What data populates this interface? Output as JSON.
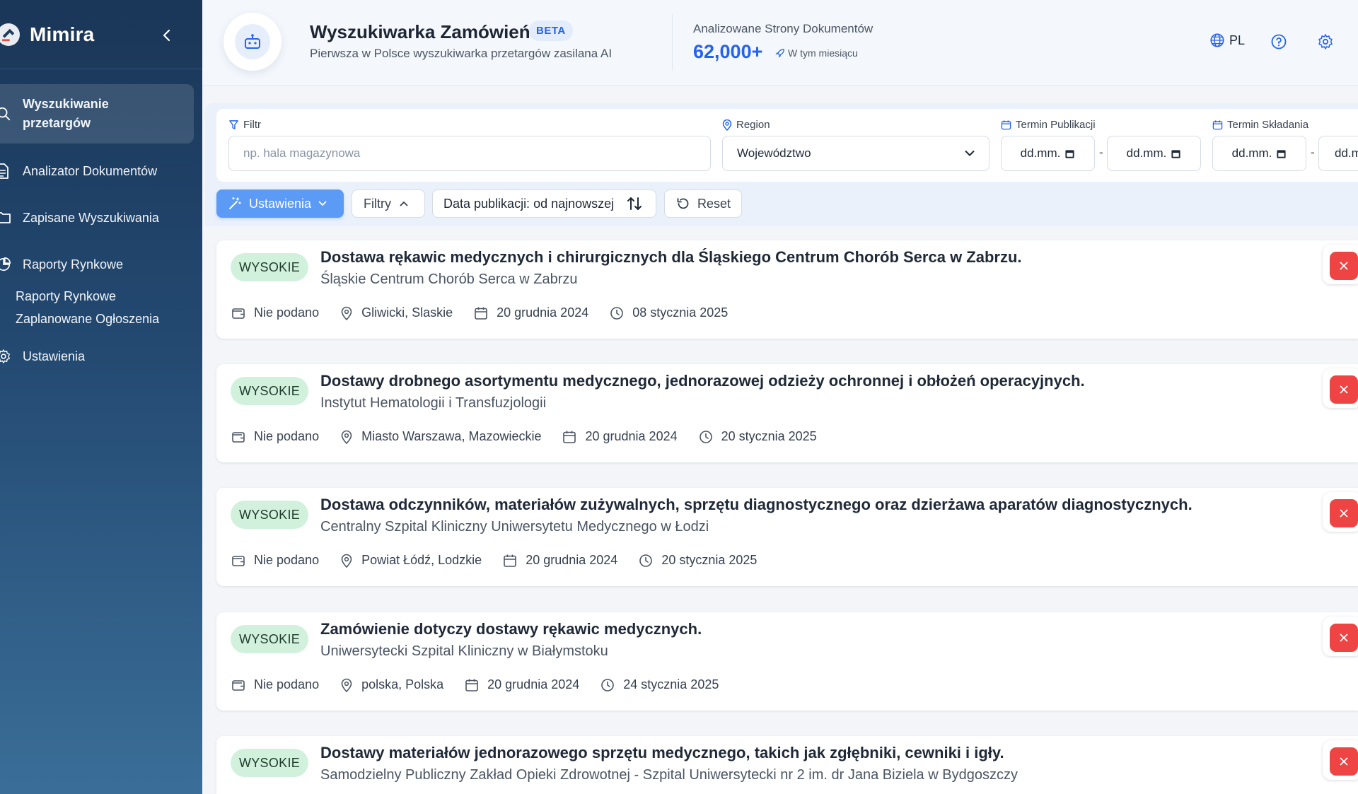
{
  "app": {
    "name": "Mimira"
  },
  "sidebar": {
    "items": [
      {
        "label": "Wyszukiwanie przetargów",
        "icon": "search-icon"
      },
      {
        "label": "Analizator Dokumentów",
        "icon": "document-icon"
      },
      {
        "label": "Zapisane Wyszukiwania",
        "icon": "folder-icon"
      },
      {
        "label": "Raporty Rynkowe",
        "icon": "pie-chart-icon"
      },
      {
        "label": "Ustawienia",
        "icon": "gear-icon"
      }
    ],
    "sub_items": [
      "Raporty Rynkowe",
      "Zaplanowane Ogłoszenia"
    ]
  },
  "header": {
    "title": "Wyszukiwarka Zamówień",
    "badge": "BETA",
    "subtitle": "Pierwsza w Polsce wyszukiwarka przetargów zasilana AI",
    "stats_label": "Analizowane Strony Dokumentów",
    "stats_value": "62,000+",
    "stats_period": "W tym miesiącu",
    "language": "PL"
  },
  "filters": {
    "filter_label": "Filtr",
    "filter_placeholder": "np. hala magazynowa",
    "region_label": "Region",
    "region_value": "Województwo",
    "pub_label": "Termin Publikacji",
    "sub_label": "Termin Składania",
    "date_placeholder": "dd.mm.",
    "date_placeholder_cut": "dd.m",
    "separator": "-"
  },
  "toolbar": {
    "settings_label": "Ustawienia",
    "filters_label": "Filtry",
    "sort_label": "Data publikacji: od najnowszej",
    "reset_label": "Reset"
  },
  "results": [
    {
      "priority": "WYSOKIE",
      "title": "Dostawa rękawic medycznych i chirurgicznych dla Śląskiego Centrum Chorób Serca w Zabrzu.",
      "organization": "Śląskie Centrum Chorób Serca w Zabrzu",
      "value": "Nie podano",
      "location": "Gliwicki, Slaskie",
      "published": "20 grudnia 2024",
      "deadline": "08 stycznia 2025"
    },
    {
      "priority": "WYSOKIE",
      "title": "Dostawy drobnego asortymentu medycznego, jednorazowej odzieży ochronnej i obłożeń operacyjnych.",
      "organization": "Instytut Hematologii i Transfuzjologii",
      "value": "Nie podano",
      "location": "Miasto Warszawa, Mazowieckie",
      "published": "20 grudnia 2024",
      "deadline": "20 stycznia 2025"
    },
    {
      "priority": "WYSOKIE",
      "title": "Dostawa odczynników, materiałów zużywalnych, sprzętu diagnostycznego oraz dzierżawa aparatów diagnostycznych.",
      "organization": "Centralny Szpital Kliniczny Uniwersytetu Medycznego w Łodzi",
      "value": "Nie podano",
      "location": "Powiat Łódź, Lodzkie",
      "published": "20 grudnia 2024",
      "deadline": "20 stycznia 2025"
    },
    {
      "priority": "WYSOKIE",
      "title": "Zamówienie dotyczy dostawy rękawic medycznych.",
      "organization": "Uniwersytecki Szpital Kliniczny w Białymstoku",
      "value": "Nie podano",
      "location": "polska, Polska",
      "published": "20 grudnia 2024",
      "deadline": "24 stycznia 2025"
    },
    {
      "priority": "WYSOKIE",
      "title": "Dostawy materiałów jednorazowego sprzętu medycznego, takich jak zgłębniki, cewniki i igły.",
      "organization": "Samodzielny Publiczny Zakład Opieki Zdrowotnej - Szpital Uniwersytecki nr 2 im. dr Jana Biziela w Bydgoszczy",
      "value": "",
      "location": "",
      "published": "",
      "deadline": ""
    }
  ],
  "colors": {
    "accent": "#2563eb",
    "priority_bg": "#d2f1dd",
    "close": "#ef4444"
  }
}
